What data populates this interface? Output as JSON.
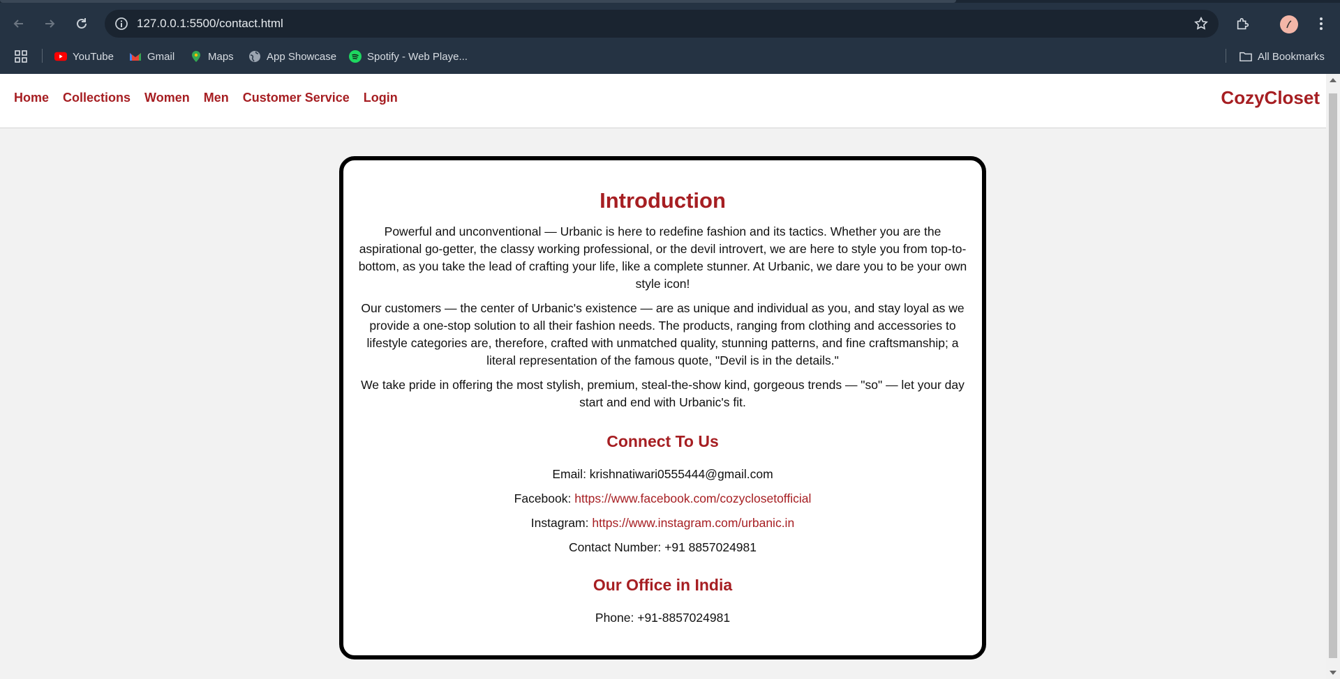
{
  "browser": {
    "url": "127.0.0.1:5500/contact.html",
    "bookmarks": [
      {
        "label": "YouTube",
        "icon": "youtube-icon"
      },
      {
        "label": "Gmail",
        "icon": "gmail-icon"
      },
      {
        "label": "Maps",
        "icon": "maps-icon"
      },
      {
        "label": "App Showcase",
        "icon": "globe-icon"
      },
      {
        "label": "Spotify - Web Playe...",
        "icon": "spotify-icon"
      }
    ],
    "all_bookmarks": "All Bookmarks"
  },
  "nav": {
    "links": [
      "Home",
      "Collections",
      "Women",
      "Men",
      "Customer Service",
      "Login"
    ],
    "brand": "CozyCloset"
  },
  "content": {
    "intro_title": "Introduction",
    "paragraphs": [
      "Powerful and unconventional — Urbanic is here to redefine fashion and its tactics. Whether you are the aspirational go-getter, the classy working professional, or the devil introvert, we are here to style you from top-to-bottom, as you take the lead of crafting your life, like a complete stunner. At Urbanic, we dare you to be your own style icon!",
      "Our customers — the center of Urbanic's existence — are as unique and individual as you, and stay loyal as we provide a one-stop solution to all their fashion needs. The products, ranging from clothing and accessories to lifestyle categories are, therefore, crafted with unmatched quality, stunning patterns, and fine craftsmanship; a literal representation of the famous quote, \"Devil is in the details.\"",
      "We take pride in offering the most stylish, premium, steal-the-show kind, gorgeous trends — \"so\" — let your day start and end with Urbanic's fit."
    ],
    "connect_title": "Connect To Us",
    "email_label": "Email: ",
    "email": "krishnatiwari0555444@gmail.com",
    "facebook_label": "Facebook: ",
    "facebook_url": "https://www.facebook.com/cozyclosetofficial",
    "instagram_label": "Instagram: ",
    "instagram_url": "https://www.instagram.com/urbanic.in",
    "contact_number": "Contact Number: +91 8857024981",
    "office_title": "Our Office in India",
    "phone": "Phone: +91-8857024981"
  },
  "colors": {
    "accent": "#a61e22",
    "chrome": "#253343"
  }
}
